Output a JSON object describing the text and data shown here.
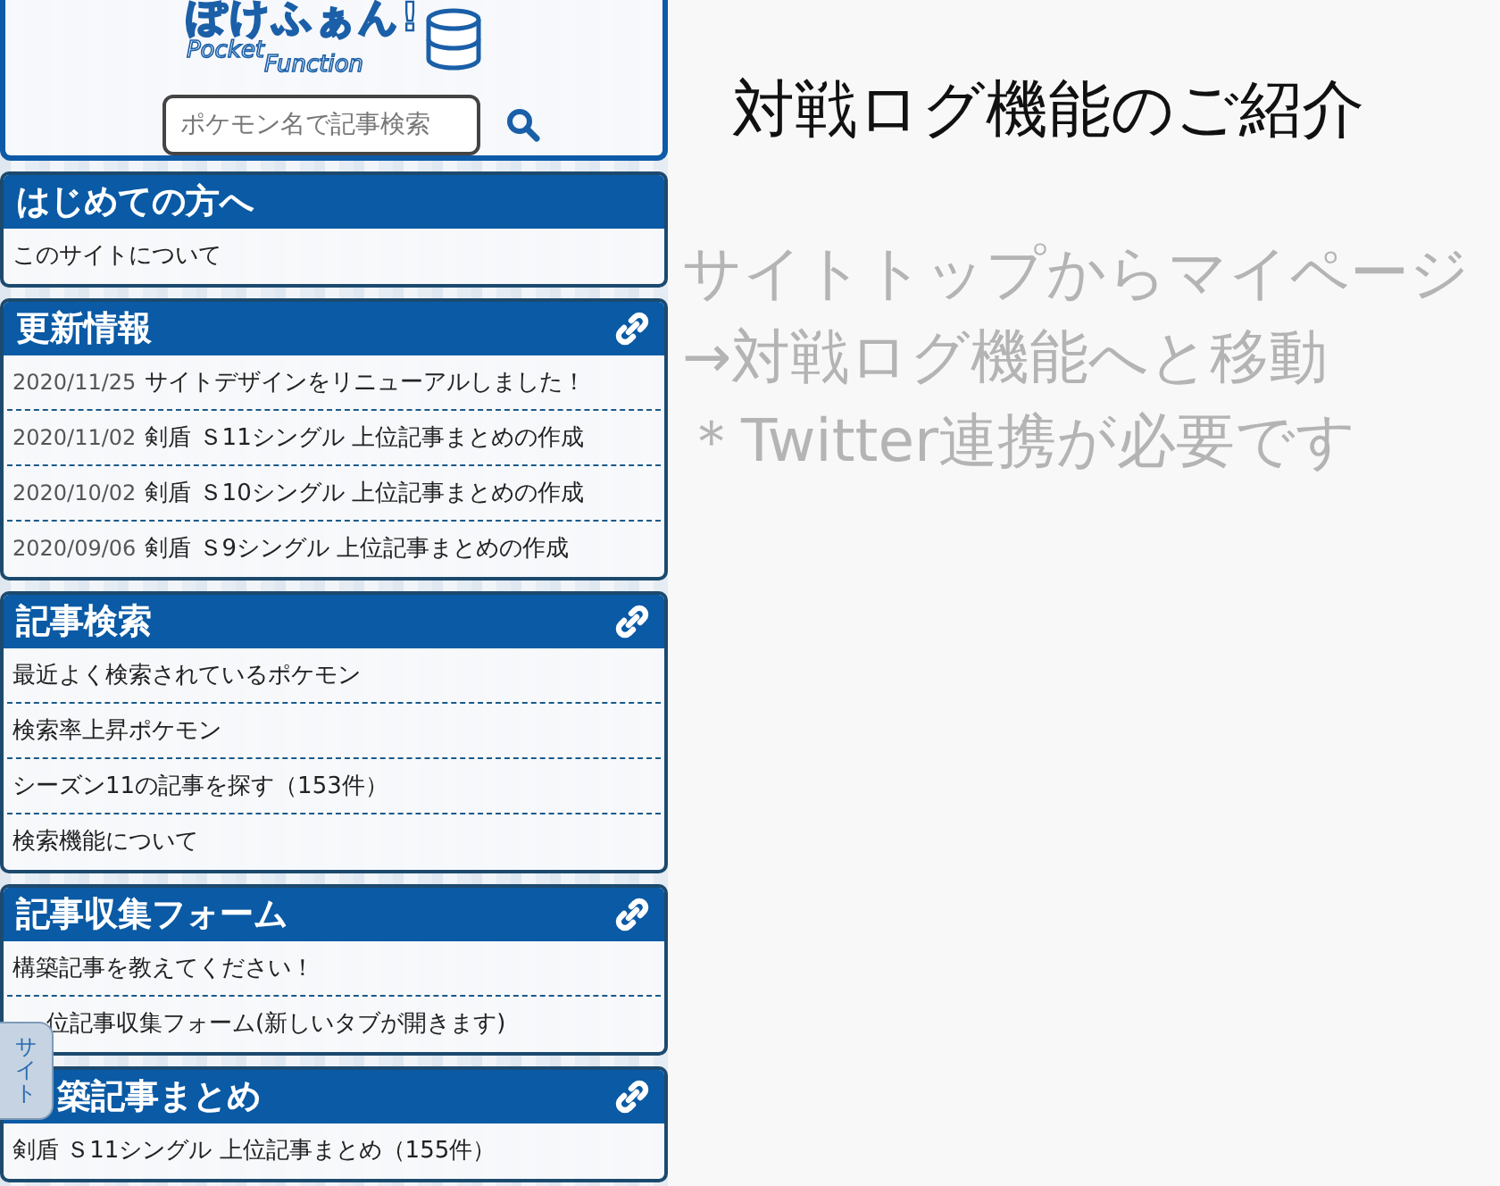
{
  "logo": {
    "main": "ぽけふぁん!",
    "sub_left": "Pocket",
    "sub_right": "Function"
  },
  "search": {
    "placeholder": "ポケモン名で記事検索"
  },
  "sections": [
    {
      "title": "はじめての方へ",
      "has_link": false,
      "items": [
        {
          "text": "このサイトについて",
          "covered": false
        }
      ]
    },
    {
      "title": "更新情報",
      "has_link": true,
      "items": [
        {
          "date": "2020/11/25",
          "text": "サイトデザインをリニューアルしました！",
          "covered": false
        },
        {
          "date": "2020/11/02",
          "text": "剣盾 Ｓ11シングル 上位記事まとめの作成",
          "covered": false
        },
        {
          "date": "2020/10/02",
          "text": "剣盾 Ｓ10シングル 上位記事まとめの作成",
          "covered": false
        },
        {
          "date": "2020/09/06",
          "text": "剣盾 Ｓ9シングル 上位記事まとめの作成",
          "covered": false
        }
      ]
    },
    {
      "title": "記事検索",
      "has_link": true,
      "items": [
        {
          "text": "最近よく検索されているポケモン",
          "covered": false
        },
        {
          "text": "検索率上昇ポケモン",
          "covered": false
        },
        {
          "text": "シーズン11の記事を探す（153件）",
          "covered": false
        },
        {
          "text": "検索機能について",
          "covered": false
        }
      ]
    },
    {
      "title": "記事収集フォーム",
      "has_link": true,
      "items": [
        {
          "text": "構築記事を教えてください！",
          "covered": false
        },
        {
          "text": "位記事収集フォーム(新しいタブが開きます)",
          "covered": true
        }
      ]
    },
    {
      "title": "築記事まとめ",
      "title_covered": true,
      "has_link": true,
      "items": [
        {
          "text": "剣盾 Ｓ11シングル 上位記事まとめ（155件）",
          "covered": false
        }
      ]
    }
  ],
  "side_tab": {
    "label": "サイト"
  },
  "main": {
    "title": "対戦ログ機能のご紹介",
    "lines": [
      "サイトトップからマイページ",
      "→対戦ログ機能へと移動",
      "＊Twitter連携が必要です"
    ]
  }
}
